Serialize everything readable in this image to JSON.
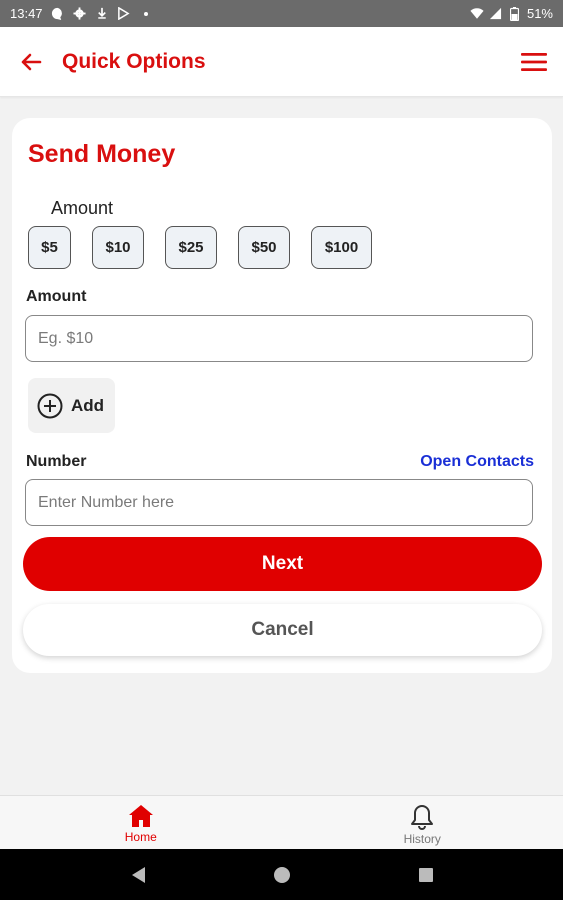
{
  "status_bar": {
    "time": "13:47",
    "battery": "51%"
  },
  "app_bar": {
    "title": "Quick Options",
    "back_icon": "arrow-left-icon",
    "menu_icon": "hamburger-menu-icon"
  },
  "send_money": {
    "title": "Send Money",
    "quick_amount_label": "Amount",
    "quick_amounts": [
      "$5",
      "$10",
      "$25",
      "$50",
      "$100"
    ],
    "amount_label": "Amount",
    "amount_placeholder": "Eg. $10",
    "amount_value": "",
    "add_label": "Add",
    "number_label": "Number",
    "open_contacts_label": "Open Contacts",
    "number_placeholder": "Enter Number here",
    "number_value": "",
    "next_label": "Next",
    "cancel_label": "Cancel"
  },
  "bottom_nav": {
    "items": [
      {
        "label": "Home",
        "icon": "home-icon",
        "active": true
      },
      {
        "label": "History",
        "icon": "bell-icon",
        "active": false
      }
    ]
  },
  "colors": {
    "brand_red": "#d90f0f",
    "button_red": "#e00000",
    "link_blue": "#1a2fd6"
  }
}
